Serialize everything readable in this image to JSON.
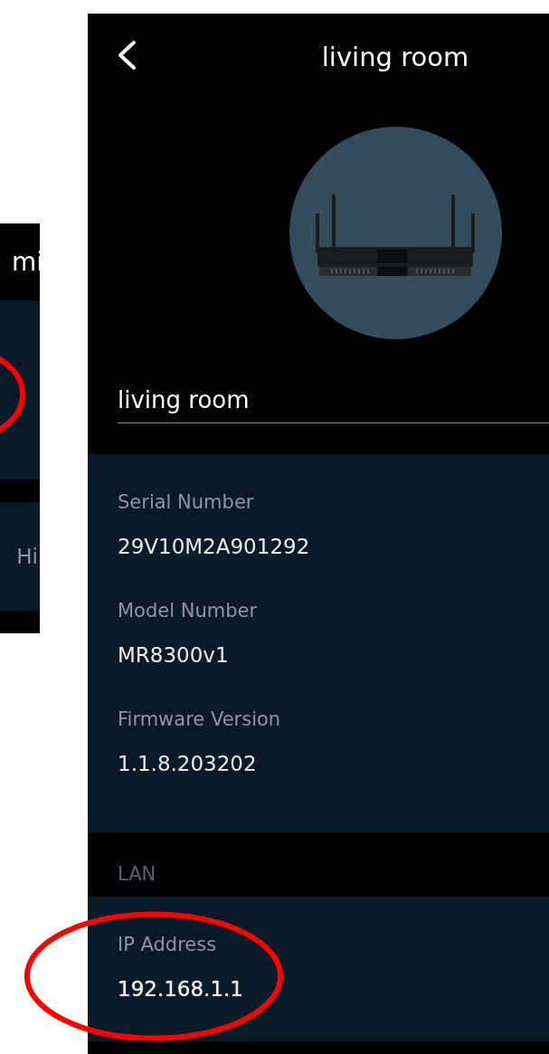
{
  "left_panel": {
    "header_text": "mi",
    "sections": [
      {
        "highlighted": true
      },
      {
        "text": "Hi",
        "highlighted": false
      }
    ]
  },
  "header": {
    "title": "living room"
  },
  "device_name": {
    "value": "living room"
  },
  "details": [
    {
      "label": "Serial Number",
      "value": "29V10M2A901292",
      "highlighted": false
    },
    {
      "label": "Model Number",
      "value": "MR8300v1",
      "highlighted": false
    },
    {
      "label": "Firmware Version",
      "value": "1.1.8.203202",
      "highlighted": false
    }
  ],
  "lan": {
    "title": "LAN",
    "fields": [
      {
        "label": "IP Address",
        "value": "192.168.1.1",
        "highlighted": true
      }
    ]
  }
}
